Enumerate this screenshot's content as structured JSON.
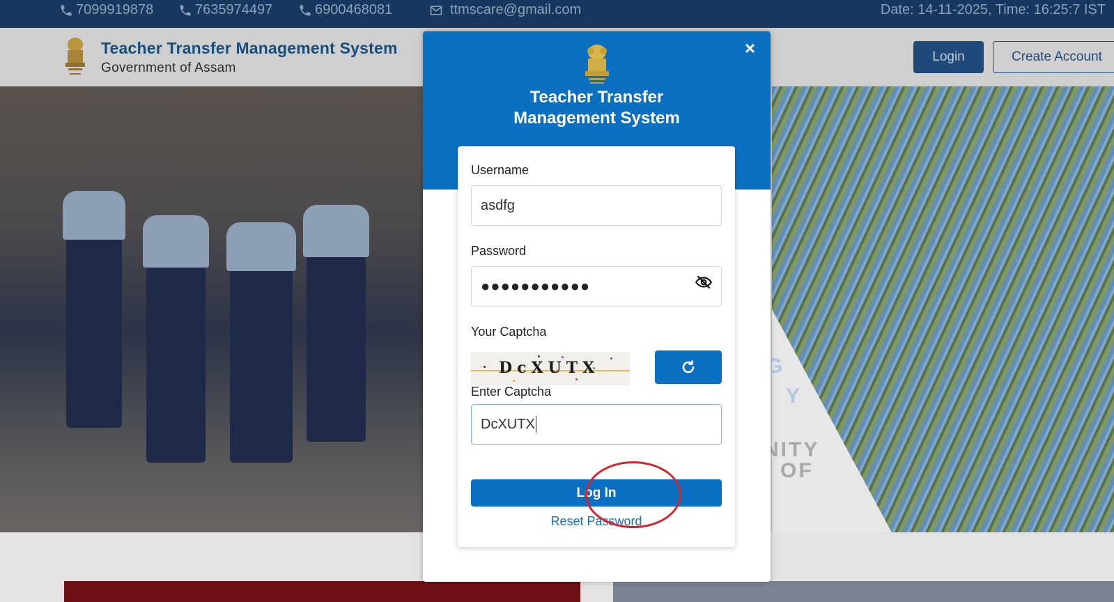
{
  "topbar": {
    "phones": [
      "7099919878",
      "7635974497",
      "6900468081"
    ],
    "email": "ttmscare@gmail.com",
    "datetime": "Date: 14-11-2025, Time: 16:25:7 IST"
  },
  "header": {
    "title": "Teacher Transfer Management System",
    "subtitle": "Government of Assam",
    "login_label": "Login",
    "create_account_label": "Create Account"
  },
  "hero": {
    "fragment_1": "G",
    "fragment_2": "Y",
    "fragment_3": "NITY",
    "fragment_4": "OF"
  },
  "modal": {
    "close_glyph": "×",
    "title_line1": "Teacher Transfer",
    "title_line2": "Management System",
    "username_label": "Username",
    "username_value": "asdfg",
    "password_label": "Password",
    "password_mask": "●●●●●●●●●●●",
    "captcha_label": "Your Captcha",
    "captcha_text": "DcXUTX",
    "enter_captcha_label": "Enter Captcha",
    "captcha_input_value": "DcXUTX",
    "login_button": "Log In",
    "reset_link": "Reset Password"
  },
  "colors": {
    "topbar": "#17375e",
    "brand_blue": "#0b70c2",
    "heading_blue": "#164e7e",
    "annotation_ring": "#d1262e"
  },
  "icons": [
    "phone-icon",
    "mail-icon",
    "state-emblem-icon",
    "close-icon",
    "eye-slash-icon",
    "refresh-icon"
  ]
}
